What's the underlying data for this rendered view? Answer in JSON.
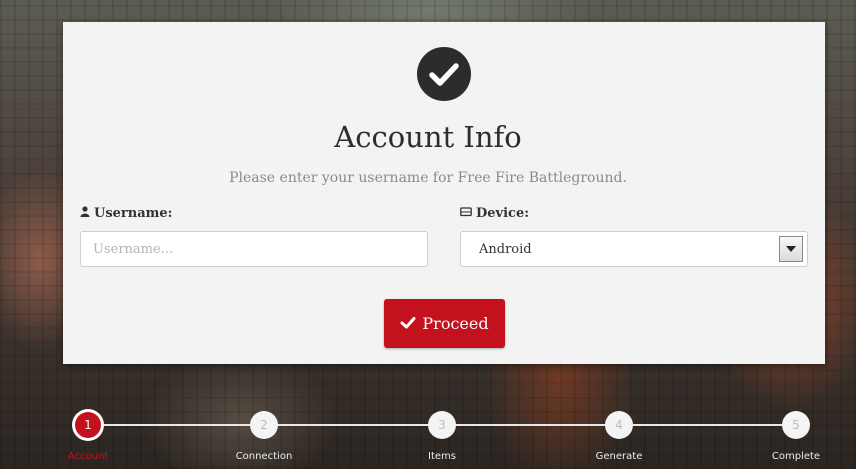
{
  "card": {
    "title": "Account Info",
    "subtitle": "Please enter your username for Free Fire Battleground."
  },
  "username": {
    "label": "Username:",
    "placeholder": "Username..."
  },
  "device": {
    "label": "Device:",
    "selected": "Android"
  },
  "proceed_label": "Proceed",
  "steps": [
    {
      "number": "1",
      "label": "Account",
      "active": true
    },
    {
      "number": "2",
      "label": "Connection"
    },
    {
      "number": "3",
      "label": "Items"
    },
    {
      "number": "4",
      "label": "Generate"
    },
    {
      "number": "5",
      "label": "Complete"
    }
  ],
  "colors": {
    "accent": "#c3111d",
    "icon_dark": "#2c2c2c",
    "card_bg": "#f3f3f3"
  },
  "icons": {
    "header": "check-circle-icon",
    "username": "user-icon",
    "device": "device-icon",
    "proceed": "check-icon",
    "select": "caret-down-icon"
  }
}
